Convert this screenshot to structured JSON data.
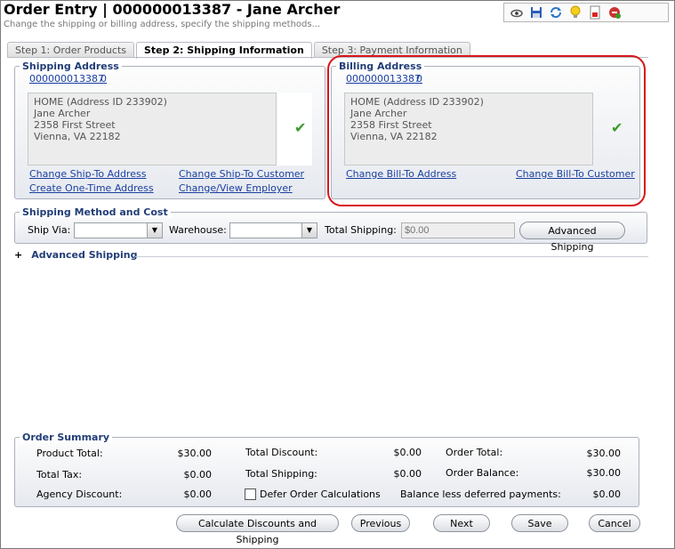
{
  "header": {
    "title": "Order Entry | 000000013387 - Jane Archer",
    "subtitle": "Change the shipping or billing address, specify the shipping methods..."
  },
  "toolbar": {
    "icons": [
      "view-icon",
      "save-icon",
      "refresh-icon",
      "tip-icon",
      "report-icon",
      "exit-icon"
    ]
  },
  "tabs": [
    {
      "label": "Step 1: Order Products"
    },
    {
      "label": "Step 2: Shipping Information"
    },
    {
      "label": "Step 3: Payment Information"
    }
  ],
  "shipping_address": {
    "legend": "Shipping Address",
    "customer_id": "000000013387",
    "customer_suffix": "0",
    "lines": [
      "HOME (Address ID 233902)",
      "Jane Archer",
      "2358 First Street",
      "Vienna, VA 22182"
    ],
    "links": {
      "change_ship_to_address": "Change Ship-To Address",
      "change_ship_to_customer": "Change Ship-To Customer",
      "create_one_time_address": "Create One-Time Address",
      "change_view_employer": "Change/View Employer"
    }
  },
  "billing_address": {
    "legend": "Billing Address",
    "customer_id": "000000013387",
    "customer_suffix": "0",
    "lines": [
      "HOME (Address ID 233902)",
      "Jane Archer",
      "2358 First Street",
      "Vienna, VA 22182"
    ],
    "links": {
      "change_bill_to_address": "Change Bill-To Address",
      "change_bill_to_customer": "Change Bill-To Customer"
    }
  },
  "shipping_method": {
    "legend": "Shipping Method and Cost",
    "ship_via_label": "Ship Via:",
    "ship_via_value": "",
    "warehouse_label": "Warehouse:",
    "warehouse_value": "",
    "total_shipping_label": "Total Shipping:",
    "total_shipping_placeholder": "$0.00",
    "advanced_button": "Advanced Shipping"
  },
  "advanced_shipping": {
    "toggle": "+",
    "label": "Advanced Shipping"
  },
  "order_summary": {
    "legend": "Order Summary",
    "product_total_label": "Product Total:",
    "product_total": "$30.00",
    "total_tax_label": "Total Tax:",
    "total_tax": "$0.00",
    "agency_discount_label": "Agency Discount:",
    "agency_discount": "$0.00",
    "total_discount_label": "Total Discount:",
    "total_discount": "$0.00",
    "total_shipping_label": "Total Shipping:",
    "total_shipping": "$0.00",
    "defer_label": "Defer Order Calculations",
    "order_total_label": "Order Total:",
    "order_total": "$30.00",
    "order_balance_label": "Order Balance:",
    "order_balance": "$30.00",
    "balance_deferred_label": "Balance less deferred payments:",
    "balance_deferred": "$0.00"
  },
  "footer_buttons": {
    "calculate": "Calculate Discounts and Shipping",
    "previous": "Previous",
    "next": "Next",
    "save": "Save",
    "cancel": "Cancel"
  },
  "colors": {
    "legend": "#213d76",
    "link": "#1a3fa0",
    "highlight_oval": "#d9161c",
    "check": "#3a9c2a"
  }
}
